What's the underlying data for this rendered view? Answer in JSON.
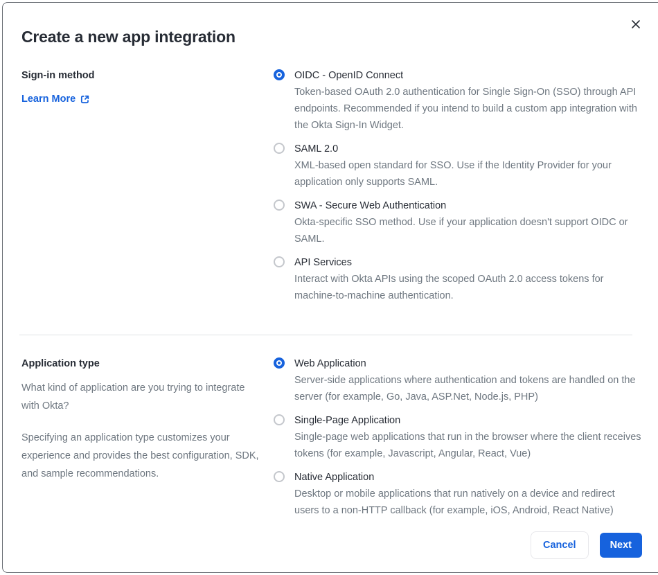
{
  "modal": {
    "title": "Create a new app integration"
  },
  "signin": {
    "heading": "Sign-in method",
    "learn_more_label": "Learn More",
    "options": [
      {
        "label": "OIDC - OpenID Connect",
        "description": "Token-based OAuth 2.0 authentication for Single Sign-On (SSO) through API endpoints. Recommended if you intend to build a custom app integration with the Okta Sign-In Widget.",
        "selected": true
      },
      {
        "label": "SAML 2.0",
        "description": "XML-based open standard for SSO. Use if the Identity Provider for your application only supports SAML.",
        "selected": false
      },
      {
        "label": "SWA - Secure Web Authentication",
        "description": "Okta-specific SSO method. Use if your application doesn't support OIDC or SAML.",
        "selected": false
      },
      {
        "label": "API Services",
        "description": "Interact with Okta APIs using the scoped OAuth 2.0 access tokens for machine-to-machine authentication.",
        "selected": false
      }
    ]
  },
  "apptype": {
    "heading": "Application type",
    "paragraphs": [
      "What kind of application are you trying to integrate with Okta?",
      "Specifying an application type customizes your experience and provides the best configuration, SDK, and sample recommendations."
    ],
    "options": [
      {
        "label": "Web Application",
        "description": "Server-side applications where authentication and tokens are handled on the server (for example, Go, Java, ASP.Net, Node.js, PHP)",
        "selected": true
      },
      {
        "label": "Single-Page Application",
        "description": "Single-page web applications that run in the browser where the client receives tokens (for example, Javascript, Angular, React, Vue)",
        "selected": false
      },
      {
        "label": "Native Application",
        "description": "Desktop or mobile applications that run natively on a device and redirect users to a non-HTTP callback (for example, iOS, Android, React Native)",
        "selected": false
      }
    ]
  },
  "footer": {
    "cancel_label": "Cancel",
    "next_label": "Next"
  },
  "icons": {
    "close": "close-icon",
    "external_link": "external-link-icon"
  },
  "colors": {
    "accent_blue": "#1662dd",
    "text_dark": "#272c35",
    "text_muted": "#6e7780",
    "radio_unselected_ring": "#c4c7cc",
    "divider": "#e0e1e5",
    "modal_border": "#696d74"
  }
}
